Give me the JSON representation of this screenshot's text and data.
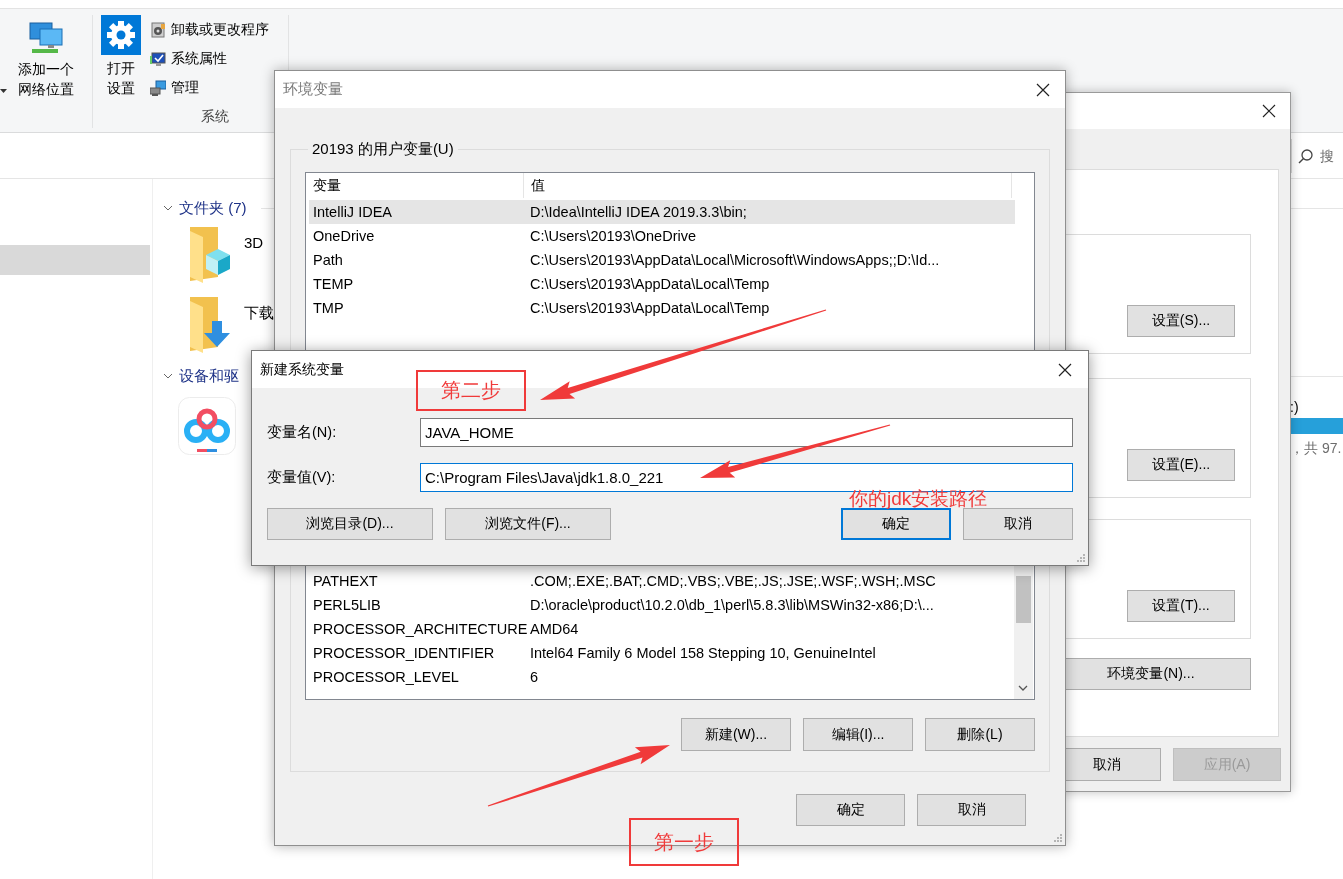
{
  "explorer": {
    "ribbon": {
      "network_button": {
        "lines": [
          "添加一个",
          "网络位置"
        ]
      },
      "settings_button": {
        "lines": [
          "打开",
          "设置"
        ]
      },
      "system_links": [
        {
          "kind": "programs",
          "label": "卸载或更改程序"
        },
        {
          "kind": "properties",
          "label": "系统属性"
        },
        {
          "kind": "manage",
          "label": "管理"
        }
      ],
      "group_label": "系统"
    },
    "search": {
      "placeholder": "搜"
    },
    "groups": [
      {
        "title": "文件夹 (7)",
        "expanded": true,
        "items": [
          {
            "kind": "objects",
            "label": "3D"
          },
          {
            "kind": "downloads",
            "label": "下载"
          }
        ]
      },
      {
        "title": "设备和驱",
        "expanded": true,
        "items": [
          {
            "kind": "netdisk"
          },
          {
            "kind": "drive",
            "label": ":)",
            "detail": "，共 97."
          }
        ]
      }
    ]
  },
  "system_properties": {
    "group_buttons": [
      "设置(S)...",
      "设置(E)...",
      "设置(T)..."
    ],
    "env_button": "环境变量(N)...",
    "footer_buttons": [
      {
        "label": "取消",
        "disabled": false
      },
      {
        "label": "应用(A)",
        "disabled": true
      }
    ]
  },
  "env_dialog": {
    "title": "环境变量",
    "user_vars": {
      "title": "20193 的用户变量(U)",
      "columns": [
        "变量",
        "值"
      ],
      "rows": [
        {
          "name": "IntelliJ IDEA",
          "value": "D:\\Idea\\IntelliJ IDEA 2019.3.3\\bin;",
          "selected": true
        },
        {
          "name": "OneDrive",
          "value": "C:\\Users\\20193\\OneDrive",
          "selected": false
        },
        {
          "name": "Path",
          "value": "C:\\Users\\20193\\AppData\\Local\\Microsoft\\WindowsApps;;D:\\Id...",
          "selected": false
        },
        {
          "name": "TEMP",
          "value": "C:\\Users\\20193\\AppData\\Local\\Temp",
          "selected": false
        },
        {
          "name": "TMP",
          "value": "C:\\Users\\20193\\AppData\\Local\\Temp",
          "selected": false
        }
      ]
    },
    "system_vars": {
      "rows": [
        {
          "name": "PATHEXT",
          "value": ".COM;.EXE;.BAT;.CMD;.VBS;.VBE;.JS;.JSE;.WSF;.WSH;.MSC",
          "selected": false
        },
        {
          "name": "PERL5LIB",
          "value": "D:\\oracle\\product\\10.2.0\\db_1\\perl\\5.8.3\\lib\\MSWin32-x86;D:\\...",
          "selected": false
        },
        {
          "name": "PROCESSOR_ARCHITECTURE",
          "value": "AMD64",
          "selected": false
        },
        {
          "name": "PROCESSOR_IDENTIFIER",
          "value": "Intel64 Family 6 Model 158 Stepping 10, GenuineIntel",
          "selected": false
        },
        {
          "name": "PROCESSOR_LEVEL",
          "value": "6",
          "selected": false
        }
      ]
    },
    "system_buttons": [
      "新建(W)...",
      "编辑(I)...",
      "删除(L)"
    ],
    "footer_buttons": [
      "确定",
      "取消"
    ]
  },
  "new_variable_dialog": {
    "title": "新建系统变量",
    "fields": [
      {
        "label": "变量名(N):",
        "value": "JAVA_HOME",
        "focused": false
      },
      {
        "label": "变量值(V):",
        "value": "C:\\Program Files\\Java\\jdk1.8.0_221",
        "focused": true
      }
    ],
    "buttons": [
      {
        "label": "浏览目录(D)...",
        "default": false
      },
      {
        "label": "浏览文件(F)...",
        "default": false
      },
      {
        "label": "确定",
        "default": true
      },
      {
        "label": "取消",
        "default": false
      }
    ]
  },
  "annotations": [
    {
      "kind": "arrow"
    },
    {
      "kind": "boxed",
      "text": "第二步"
    },
    {
      "kind": "arrow"
    },
    {
      "kind": "text",
      "text": "你的jdk安装路径"
    },
    {
      "kind": "arrow"
    },
    {
      "kind": "boxed",
      "text": "第一步"
    }
  ]
}
